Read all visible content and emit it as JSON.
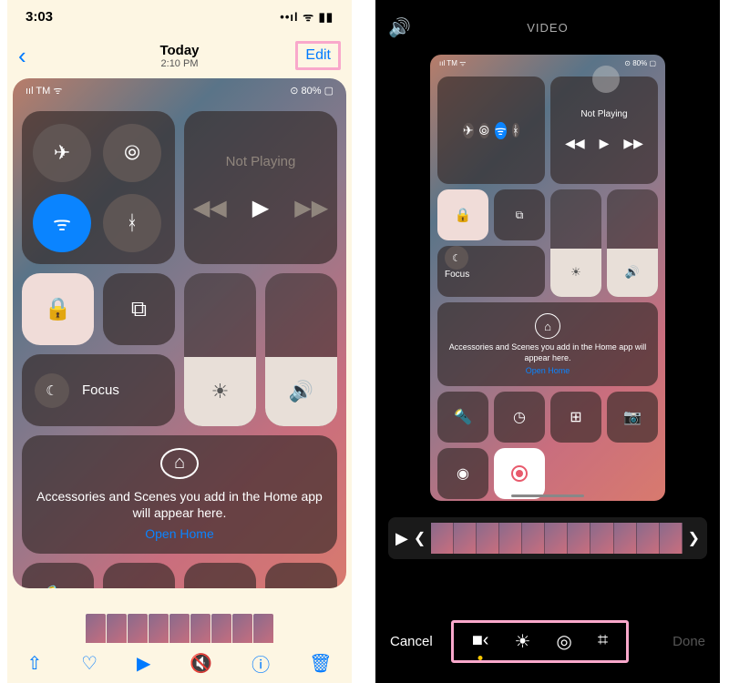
{
  "left": {
    "status_time": "3:03",
    "status_icons": "••ıl ᯤ ▮▮",
    "nav": {
      "day": "Today",
      "time": "2:10 PM",
      "edit": "Edit"
    },
    "preview_status": {
      "carrier": "ııl TM ᯤ",
      "right": "⊙ 80% ▢"
    },
    "media": {
      "not_playing": "Not Playing"
    },
    "focus": "Focus",
    "home": {
      "msg": "Accessories and Scenes you add in the Home app will appear here.",
      "link": "Open Home"
    },
    "toolbar": {
      "share": "⇧",
      "heart": "♡",
      "play": "▶",
      "mute": "🔇",
      "info": "ⓘ",
      "trash": "🗑"
    }
  },
  "right": {
    "title": "VIDEO",
    "preview_status": {
      "carrier": "ııl TM ᯤ",
      "right": "⊙ 80% ▢"
    },
    "media": {
      "not_playing": "Not Playing"
    },
    "focus": "Focus",
    "home": {
      "msg": "Accessories and Scenes you add in the Home app will appear here.",
      "link": "Open Home"
    },
    "actions": {
      "cancel": "Cancel",
      "done": "Done"
    }
  }
}
